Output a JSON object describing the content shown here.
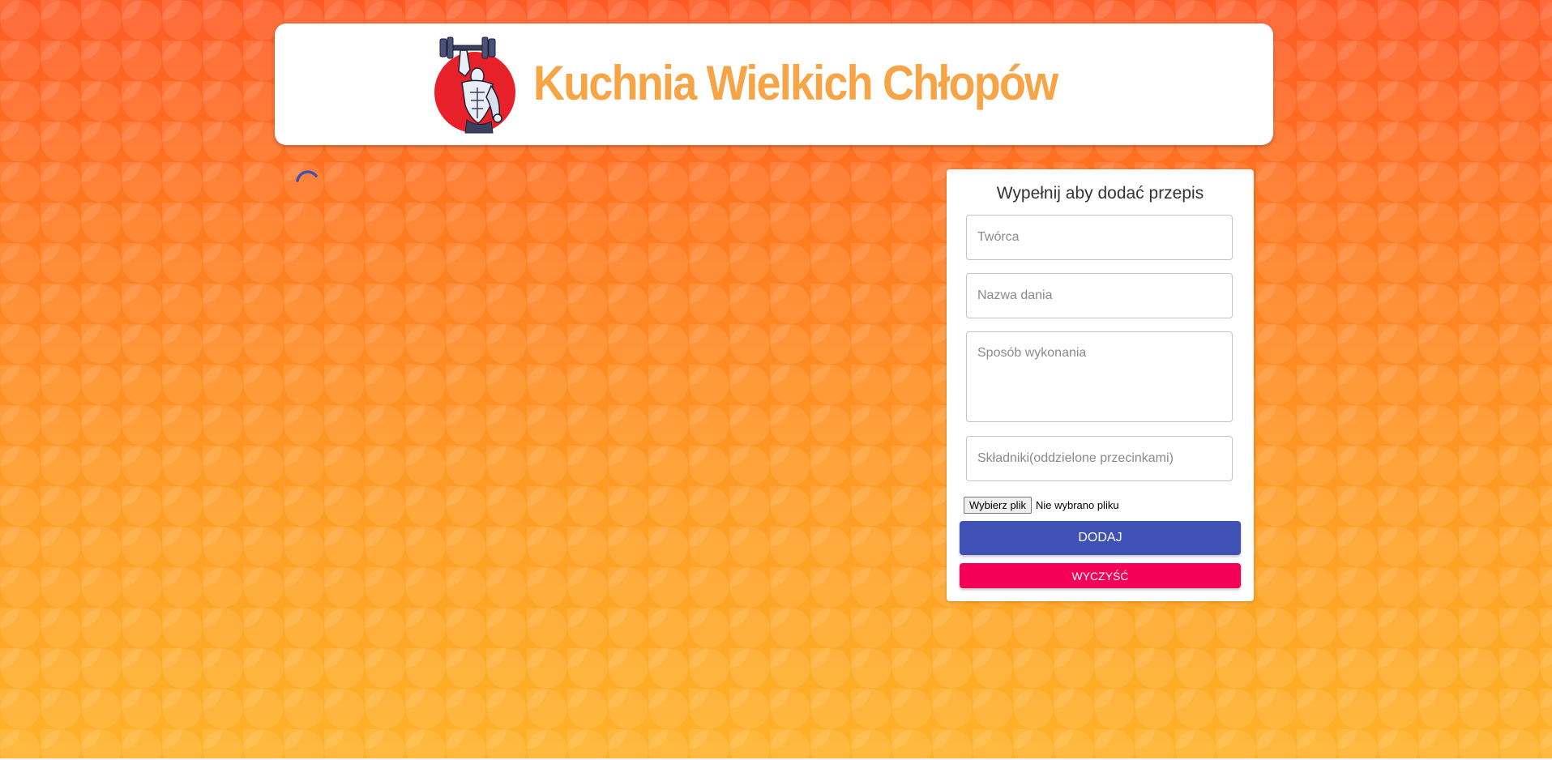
{
  "header": {
    "title": "Kuchnia Wielkich Chłopów",
    "logo_icon": "bodybuilder-dumbbell-logo-icon"
  },
  "loading": {
    "icon": "loading-spinner-icon",
    "color": "#3f51b5"
  },
  "form": {
    "title": "Wypełnij aby dodać przepis",
    "author_placeholder": "Twórca",
    "author_value": "",
    "dish_placeholder": "Nazwa dania",
    "dish_value": "",
    "method_placeholder": "Sposób wykonania",
    "method_value": "",
    "ingredients_placeholder": "Składniki(oddzielone przecinkami)",
    "ingredients_value": "",
    "file_button_label": "Wybierz plik",
    "file_status": "Nie wybrano pliku",
    "add_button_label": "DODAJ",
    "clear_button_label": "WYCZYŚĆ"
  },
  "colors": {
    "primary": "#3f51b5",
    "secondary": "#f50057",
    "title_orange": "#f7a447",
    "logo_red": "#e8202a"
  }
}
